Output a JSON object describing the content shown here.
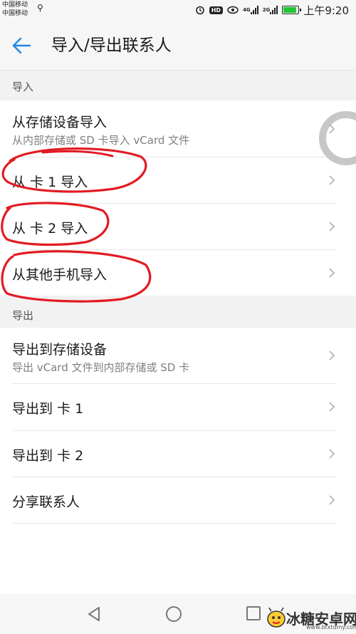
{
  "status_bar": {
    "carrier_1": "中国移动",
    "carrier_2": "中国移动",
    "hd": "HD",
    "signal_1": "4G",
    "signal_2": "2G",
    "time": "上午9:20"
  },
  "app_bar": {
    "title": "导入/导出联系人"
  },
  "import_section": {
    "header": "导入",
    "items": [
      {
        "label": "从存储设备导入",
        "sub": "从内部存储或 SD 卡导入 vCard 文件"
      },
      {
        "label": "从 卡 1 导入"
      },
      {
        "label": "从 卡 2 导入"
      },
      {
        "label": "从其他手机导入"
      }
    ]
  },
  "export_section": {
    "header": "导出",
    "items": [
      {
        "label": "导出到存储设备",
        "sub": "导出 vCard 文件到内部存储或 SD 卡"
      },
      {
        "label": "导出到 卡 1"
      },
      {
        "label": "导出到 卡 2"
      },
      {
        "label": "分享联系人"
      }
    ]
  },
  "watermark": {
    "text": "冰糖安卓网",
    "url": "www.btxtdmy.com"
  },
  "colors": {
    "accent": "#1e88e5",
    "annotation": "#e21b23",
    "battery": "#22c532"
  }
}
